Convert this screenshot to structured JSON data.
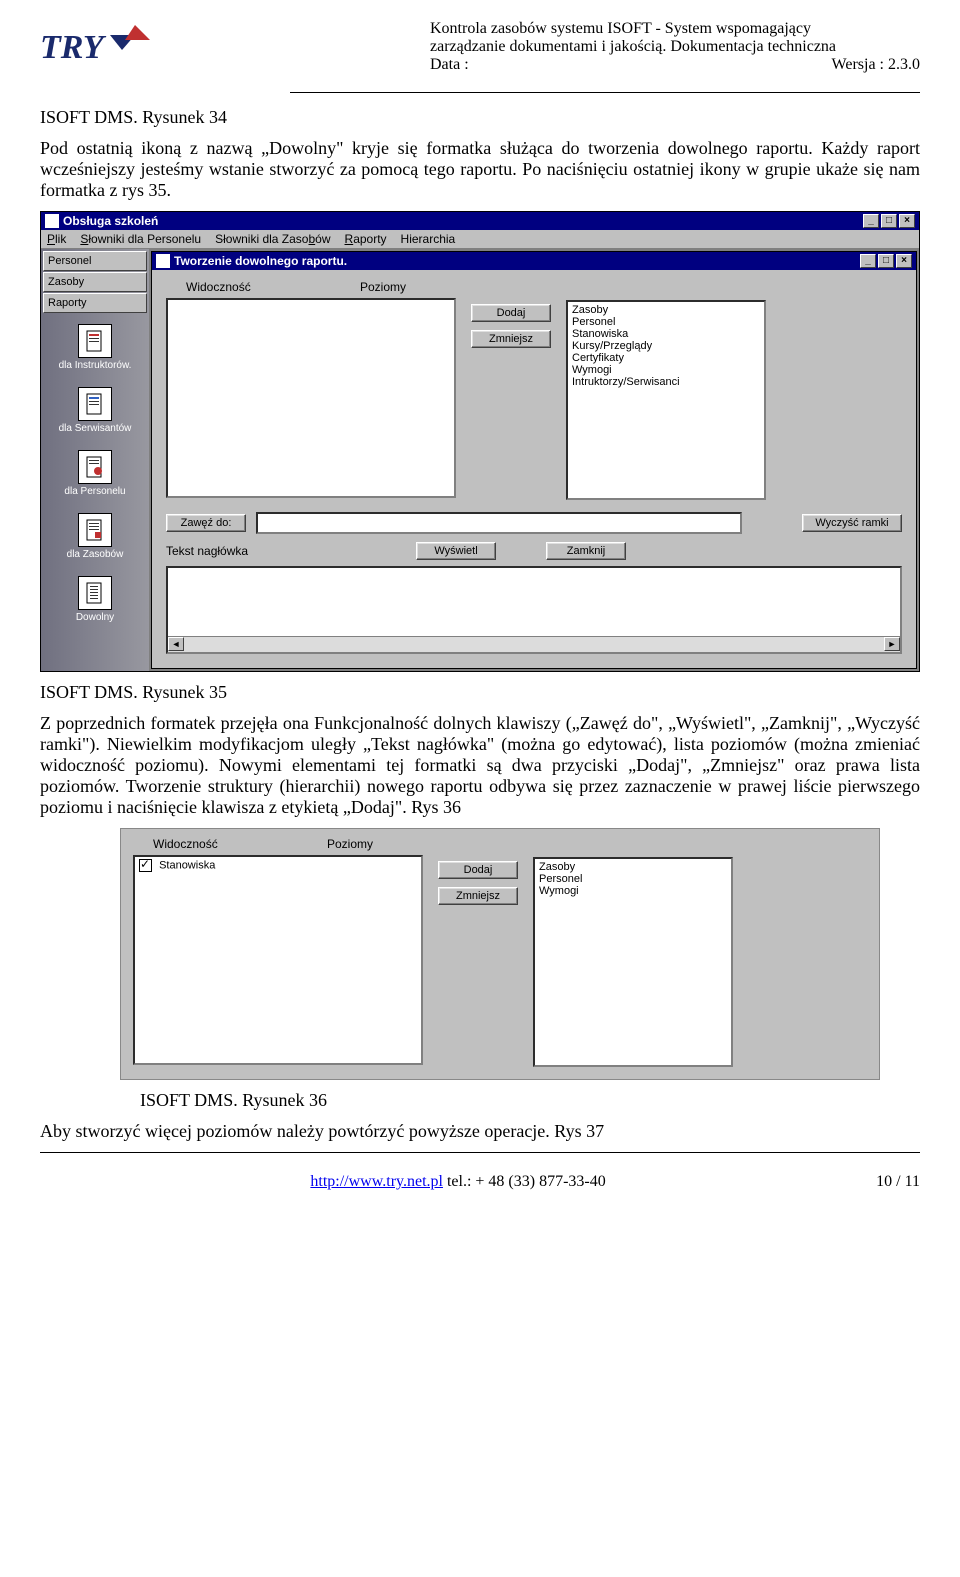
{
  "header": {
    "line1": "Kontrola zasobów systemu ISOFT - System wspomagający",
    "line2": "zarządzanie dokumentami i jakością. Dokumentacja techniczna",
    "line3left": "Data :",
    "line3right": "Wersja : 2.3.0"
  },
  "caption34": "ISOFT DMS. Rysunek 34",
  "para1": "Pod ostatnią ikoną z nazwą „Dowolny\" kryje się formatka służąca do tworzenia dowolnego raportu. Każdy raport wcześniejszy jesteśmy wstanie stworzyć za pomocą tego raportu. Po naciśnięciu ostatniej ikony w grupie ukaże się nam formatka z rys 35.",
  "win35": {
    "title": "Obsługa szkoleń",
    "menu": [
      "Plik",
      "Słowniki dla Personelu",
      "Słowniki dla Zasobów",
      "Raporty",
      "Hierarchia"
    ],
    "leftTabs": [
      "Personel",
      "Zasoby",
      "Raporty"
    ],
    "leftItems": [
      "dla Instruktorów.",
      "dla Serwisantów",
      "dla Personelu",
      "dla Zasobów",
      "Dowolny"
    ],
    "innerTitle": "Tworzenie dowolnego raportu.",
    "labelWidocznosc": "Widoczność",
    "labelPoziomy": "Poziomy",
    "rightList": [
      "Zasoby",
      "Personel",
      "Stanowiska",
      "Kursy/Przeglądy",
      "Certyfikaty",
      "Wymogi",
      "Intruktorzy/Serwisanci"
    ],
    "btnDodaj": "Dodaj",
    "btnZmniejsz": "Zmniejsz",
    "btnZawez": "Zawęź do:",
    "btnWyczysc": "Wyczyść ramki",
    "btnWyswietl": "Wyświetl",
    "btnZamknij": "Zamknij",
    "labelTekst": "Tekst nagłówka"
  },
  "caption35": "ISOFT DMS. Rysunek 35",
  "para2": "Z poprzednich formatek przejęła ona Funkcjonalność dolnych klawiszy („Zawęź do\", „Wyświetl\", „Zamknij\", „Wyczyść ramki\"). Niewielkim modyfikacjom uległy „Tekst nagłówka\" (można go edytować), lista poziomów (można zmieniać widoczność poziomu). Nowymi elementami tej formatki są dwa przyciski „Dodaj\", „Zmniejsz\" oraz prawa lista poziomów. Tworzenie struktury (hierarchii) nowego raportu odbywa się przez zaznaczenie w prawej liście pierwszego poziomu i naciśnięcie klawisza z etykietą „Dodaj\". Rys 36",
  "fig36": {
    "labelWidocznosc": "Widoczność",
    "labelPoziomy": "Poziomy",
    "leftItem": "Stanowiska",
    "rightList": [
      "Zasoby",
      "Personel",
      "Wymogi"
    ],
    "btnDodaj": "Dodaj",
    "btnZmniejsz": "Zmniejsz"
  },
  "caption36": "ISOFT DMS. Rysunek 36",
  "para3": "Aby stworzyć więcej poziomów należy powtórzyć powyższe operacje. Rys 37",
  "footer": {
    "link": "http://www.try.net.pl",
    "tel": "  tel.: + 48 (33) 877-33-40",
    "page": "10 / 11"
  }
}
